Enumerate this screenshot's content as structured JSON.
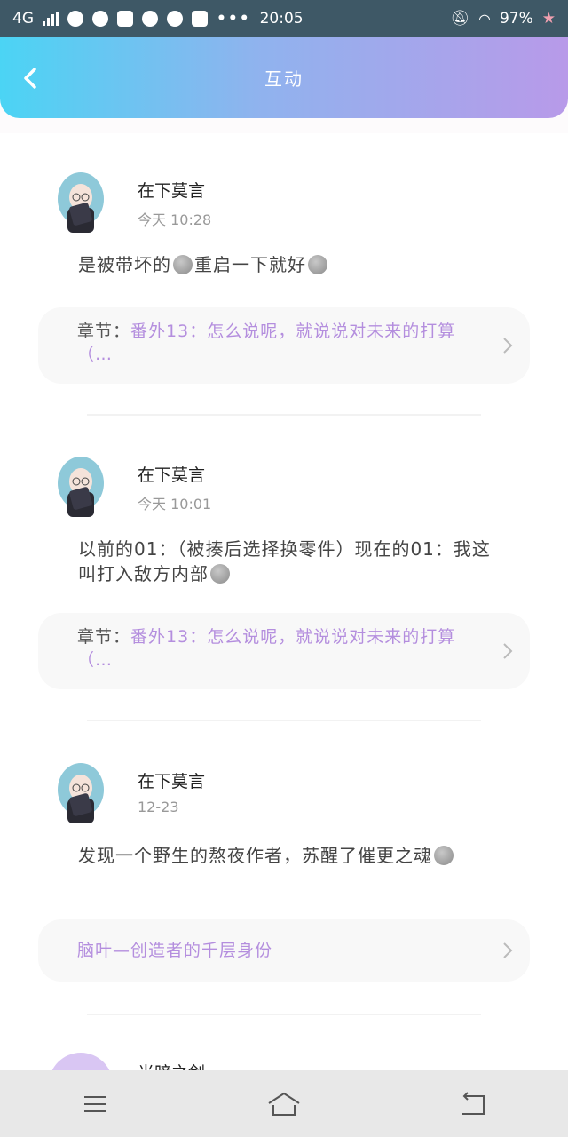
{
  "status_bar": {
    "network": "4G",
    "time": "20:05",
    "battery": "97%"
  },
  "header": {
    "title": "互动"
  },
  "posts": [
    {
      "author": "在下莫言",
      "time": "今天 10:28",
      "message_parts": [
        "是被带坏的",
        "重启一下就好"
      ],
      "card_prefix": "章节：",
      "card_text": "番外13：怎么说呢，就说说对未来的打算（…"
    },
    {
      "author": "在下莫言",
      "time": "今天 10:01",
      "message_parts": [
        "以前的01：（被揍后选择换零件）现在的01：我这叫打入敌方内部"
      ],
      "card_prefix": "章节：",
      "card_text": "番外13：怎么说呢，就说说对未来的打算（…"
    },
    {
      "author": "在下莫言",
      "time": "12-23",
      "message_parts": [
        "发现一个野生的熬夜作者，苏醒了催更之魂"
      ],
      "card_text": "脑叶—创造者的千层身份"
    },
    {
      "author": "光暗之剑"
    }
  ],
  "icons": {
    "back": "chevron-left-icon",
    "emoji": "gray-face-emoji-icon",
    "card_arrow": "chevron-right-icon",
    "nav_menu": "menu-icon",
    "nav_home": "home-icon",
    "nav_back": "return-icon"
  },
  "colors": {
    "header_gradient_start": "#4bd4f4",
    "header_gradient_end": "#b89ae9",
    "link": "#b48ede",
    "status_bar": "#3e5866"
  }
}
